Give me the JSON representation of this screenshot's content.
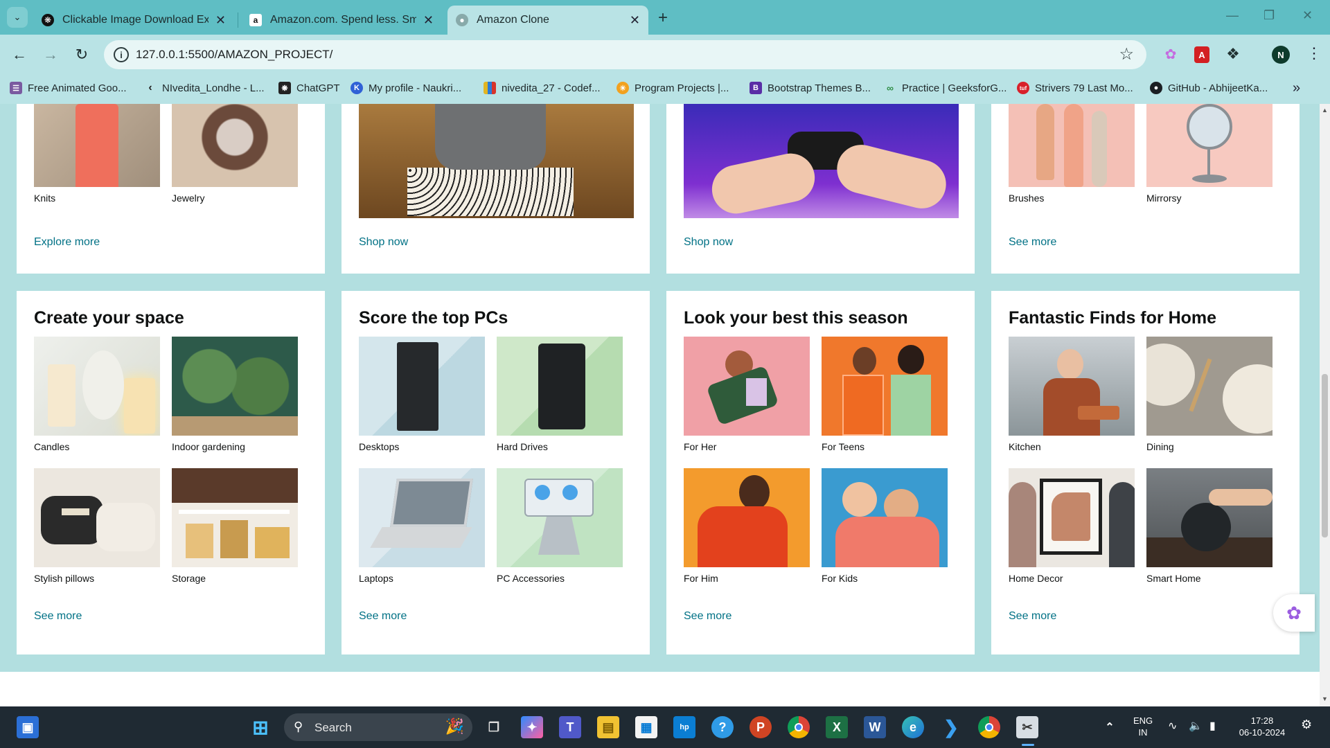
{
  "browser": {
    "tabs": [
      {
        "title": "Clickable Image Download Exa",
        "active": false
      },
      {
        "title": "Amazon.com. Spend less. Smile",
        "active": false
      },
      {
        "title": "Amazon Clone",
        "active": true
      }
    ],
    "url": "127.0.0.1:5500/AMAZON_PROJECT/",
    "profile_initial": "N",
    "bookmarks": [
      "Free Animated Goo...",
      "NIvedita_Londhe - L...",
      "ChatGPT",
      "My profile - Naukri...",
      "nivedita_27 - Codef...",
      "Program Projects |...",
      "Bootstrap Themes B...",
      "Practice | GeeksforG...",
      "Strivers 79 Last Mo...",
      "GitHub - AbhijeetKa..."
    ]
  },
  "page": {
    "top_row": [
      {
        "items": [
          "Knits",
          "Jewelry"
        ],
        "link": "Explore more"
      },
      {
        "link": "Shop now"
      },
      {
        "link": "Shop now"
      },
      {
        "items": [
          "Brushes",
          "Mirrorsy"
        ],
        "link": "See more"
      }
    ],
    "cards": [
      {
        "title": "Create your space",
        "items": [
          "Candles",
          "Indoor gardening",
          "Stylish pillows",
          "Storage"
        ],
        "link": "See more"
      },
      {
        "title": "Score the top PCs",
        "items": [
          "Desktops",
          "Hard Drives",
          "Laptops",
          "PC Accessories"
        ],
        "link": "See more"
      },
      {
        "title": "Look your best this season",
        "items": [
          "For Her",
          "For Teens",
          "For Him",
          "For Kids"
        ],
        "link": "See more"
      },
      {
        "title": "Fantastic Finds for Home",
        "items": [
          "Kitchen",
          "Dining",
          "Home Decor",
          "Smart Home"
        ],
        "link": "See more"
      }
    ]
  },
  "taskbar": {
    "search_label": "Search",
    "lang_top": "ENG",
    "lang_bottom": "IN",
    "time": "17:28",
    "date": "06-10-2024"
  },
  "colors": {
    "page_bg": "#b2dfe0",
    "link": "#007185",
    "tabbar": "#5fbec4"
  }
}
